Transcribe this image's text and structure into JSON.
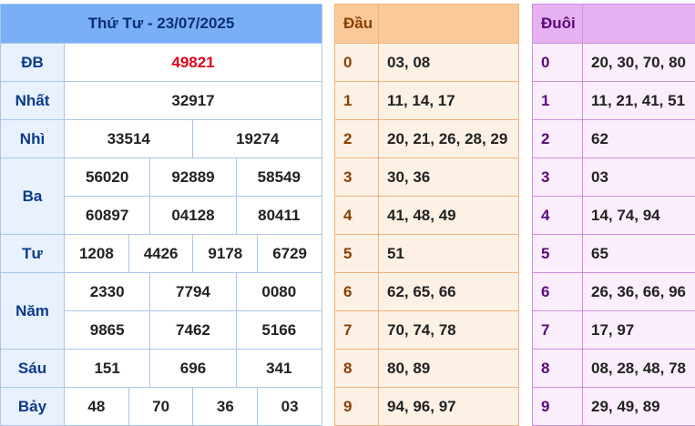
{
  "results": {
    "title": "Thứ Tư - 23/07/2025",
    "prizes": {
      "db": {
        "label": "ĐB",
        "values": [
          "49821"
        ]
      },
      "nhat": {
        "label": "Nhất",
        "values": [
          "32917"
        ]
      },
      "nhi": {
        "label": "Nhì",
        "values": [
          "33514",
          "19274"
        ]
      },
      "ba": {
        "label": "Ba",
        "values": [
          "56020",
          "92889",
          "58549",
          "60897",
          "04128",
          "80411"
        ]
      },
      "tu": {
        "label": "Tư",
        "values": [
          "1208",
          "4426",
          "9178",
          "6729"
        ]
      },
      "nam": {
        "label": "Năm",
        "values": [
          "2330",
          "7794",
          "0080",
          "9865",
          "7462",
          "5166"
        ]
      },
      "sau": {
        "label": "Sáu",
        "values": [
          "151",
          "696",
          "341"
        ]
      },
      "bay": {
        "label": "Bảy",
        "values": [
          "48",
          "70",
          "36",
          "03"
        ]
      }
    },
    "colors": {
      "header_bg": "#7aaef6",
      "special_prize": "#e3001b",
      "label_text": "#0b3a8c"
    }
  },
  "dau": {
    "title": "Đầu",
    "rows": [
      {
        "digit": "0",
        "nums": "03, 08"
      },
      {
        "digit": "1",
        "nums": "11, 14, 17"
      },
      {
        "digit": "2",
        "nums": "20, 21, 26, 28, 29"
      },
      {
        "digit": "3",
        "nums": "30, 36"
      },
      {
        "digit": "4",
        "nums": "41, 48, 49"
      },
      {
        "digit": "5",
        "nums": "51"
      },
      {
        "digit": "6",
        "nums": "62, 65, 66"
      },
      {
        "digit": "7",
        "nums": "70, 74, 78"
      },
      {
        "digit": "8",
        "nums": "80, 89"
      },
      {
        "digit": "9",
        "nums": "94, 96, 97"
      }
    ],
    "colors": {
      "header_bg": "#fac99a",
      "body_bg": "#fdf1e6"
    }
  },
  "duoi": {
    "title": "Đuôi",
    "rows": [
      {
        "digit": "0",
        "nums": "20, 30, 70, 80"
      },
      {
        "digit": "1",
        "nums": "11, 21, 41, 51"
      },
      {
        "digit": "2",
        "nums": "62"
      },
      {
        "digit": "3",
        "nums": "03"
      },
      {
        "digit": "4",
        "nums": "14, 74, 94"
      },
      {
        "digit": "5",
        "nums": "65"
      },
      {
        "digit": "6",
        "nums": "26, 36, 66, 96"
      },
      {
        "digit": "7",
        "nums": "17, 97"
      },
      {
        "digit": "8",
        "nums": "08, 28, 48, 78"
      },
      {
        "digit": "9",
        "nums": "29, 49, 89"
      }
    ],
    "colors": {
      "header_bg": "#e6b0f1",
      "body_bg": "#fbeefc"
    }
  }
}
